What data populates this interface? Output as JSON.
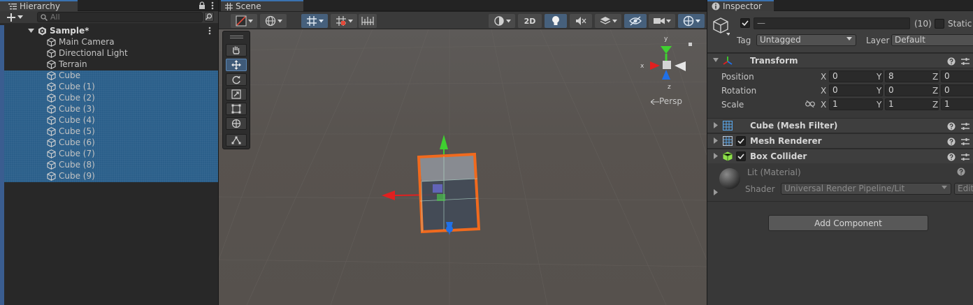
{
  "hierarchy": {
    "tab_title": "Hierarchy",
    "search_placeholder": "All",
    "scene_name": "Sample*",
    "items": [
      {
        "label": "Main Camera"
      },
      {
        "label": "Directional Light"
      },
      {
        "label": "Terrain"
      },
      {
        "label": "Cube"
      },
      {
        "label": "Cube (1)"
      },
      {
        "label": "Cube (2)"
      },
      {
        "label": "Cube (3)"
      },
      {
        "label": "Cube (4)"
      },
      {
        "label": "Cube (5)"
      },
      {
        "label": "Cube (6)"
      },
      {
        "label": "Cube (7)"
      },
      {
        "label": "Cube (8)"
      },
      {
        "label": "Cube (9)"
      }
    ]
  },
  "scene": {
    "tab_title": "Scene",
    "toolbar": {
      "mode_2d": "2D"
    },
    "persp_label": "Persp",
    "gizmo_axes": {
      "x": "x",
      "y": "y",
      "z": "z"
    }
  },
  "inspector": {
    "tab_title": "Inspector",
    "name_value": "—",
    "count": "(10)",
    "static_label": "Static",
    "tag_label": "Tag",
    "tag_value": "Untagged",
    "layer_label": "Layer",
    "layer_value": "Default",
    "transform": {
      "title": "Transform",
      "rows": [
        {
          "label": "Position",
          "x": "0",
          "y": "8",
          "z": "0"
        },
        {
          "label": "Rotation",
          "x": "0",
          "y": "0",
          "z": "0"
        },
        {
          "label": "Scale",
          "x": "1",
          "y": "1",
          "z": "1"
        }
      ],
      "axis_x": "X",
      "axis_y": "Y",
      "axis_z": "Z"
    },
    "components": [
      {
        "title": "Cube (Mesh Filter)"
      },
      {
        "title": "Mesh Renderer"
      },
      {
        "title": "Box Collider"
      }
    ],
    "material": {
      "name": "Lit (Material)",
      "shader_label": "Shader",
      "shader_value": "Universal Render Pipeline/Lit",
      "edit_label": "Edit"
    },
    "add_component": "Add Component"
  },
  "colors": {
    "accent_tab": "#3a72b0",
    "selection": "#2c5d87",
    "gizmo_x": "#e02020",
    "gizmo_y": "#3fd030",
    "gizmo_z": "#2070e8",
    "selection_outline": "#f06a1e"
  }
}
